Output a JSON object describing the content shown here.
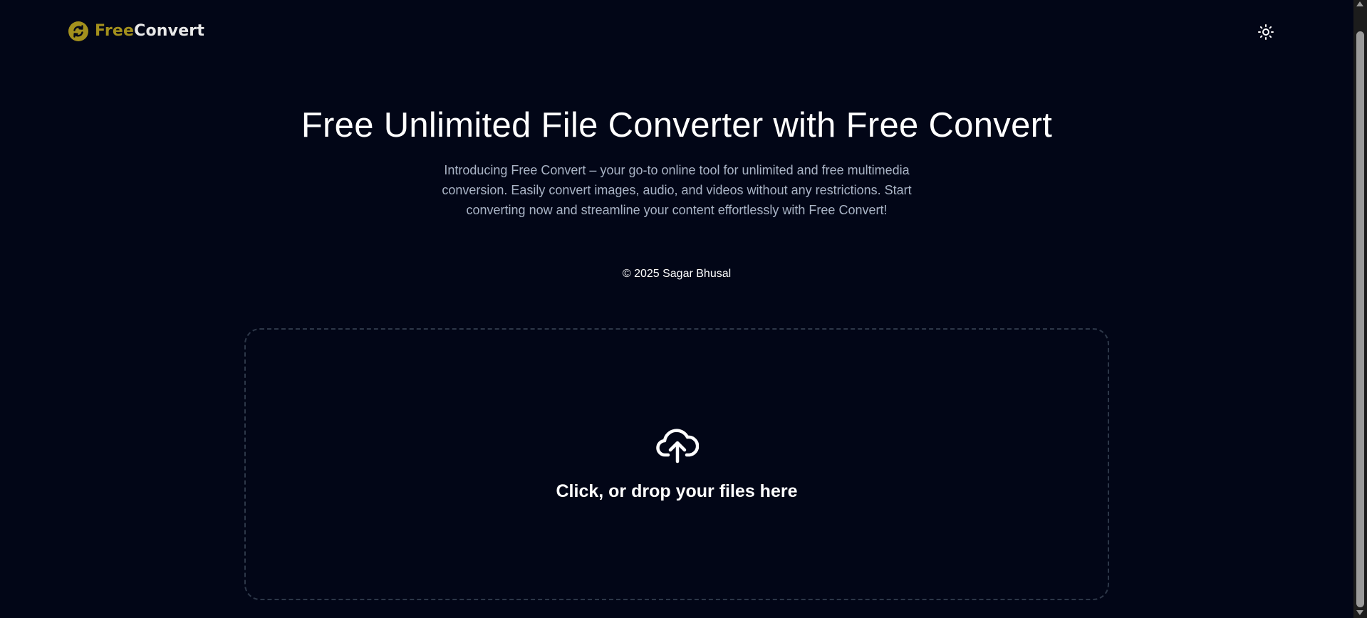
{
  "header": {
    "logo": {
      "free": "Free",
      "convert": "Convert",
      "icon": "refresh-circle-icon",
      "colors": {
        "free": "#a3901d",
        "convert": "#e8e8e8"
      }
    },
    "theme_toggle_icon": "sun-icon"
  },
  "hero": {
    "title": "Free Unlimited File Converter with Free Convert",
    "description": "Introducing Free Convert – your go-to online tool for unlimited and free multimedia conversion. Easily convert images, audio, and videos without any restrictions. Start converting now and streamline your content effortlessly with Free Convert!"
  },
  "copyright": "© 2025 Sagar Bhusal",
  "dropzone": {
    "label": "Click, or drop your files here",
    "icon": "cloud-upload-icon"
  },
  "theme": {
    "background": "#020617",
    "description_color": "#a9b4c6",
    "dropzone_border": "#2d3748"
  }
}
